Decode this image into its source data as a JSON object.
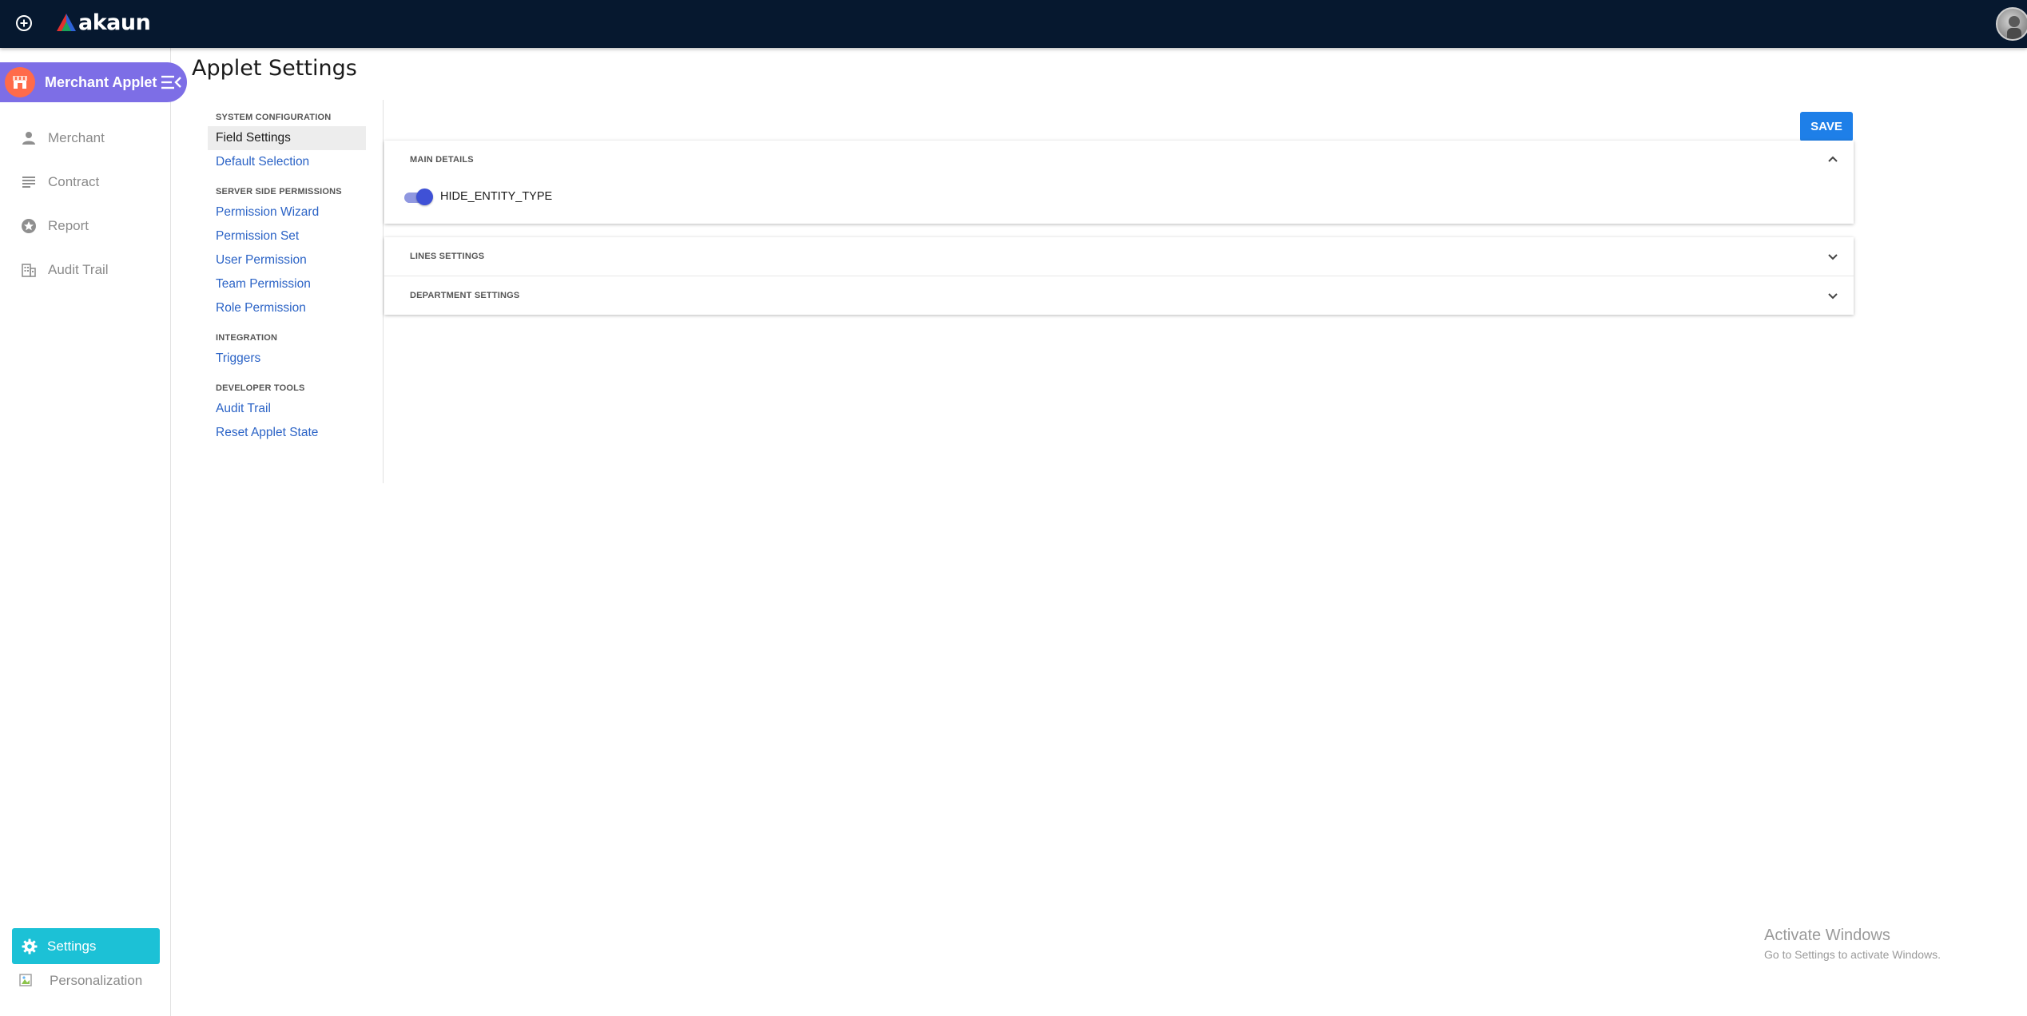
{
  "topbar": {
    "brand": "akaun",
    "add_icon": "plus-circle-icon",
    "avatar_icon": "user-avatar"
  },
  "sidebar": {
    "applet_name": "Merchant Applet",
    "items": [
      {
        "label": "Merchant",
        "icon": "person-icon"
      },
      {
        "label": "Contract",
        "icon": "list-icon"
      },
      {
        "label": "Report",
        "icon": "star-circle-icon"
      },
      {
        "label": "Audit Trail",
        "icon": "building-icon"
      }
    ],
    "settings_label": "Settings",
    "personalization_label": "Personalization"
  },
  "page": {
    "title": "Applet Settings"
  },
  "settings_nav": {
    "sections": [
      {
        "title": "SYSTEM CONFIGURATION",
        "links": [
          "Field Settings",
          "Default Selection"
        ]
      },
      {
        "title": "SERVER SIDE PERMISSIONS",
        "links": [
          "Permission Wizard",
          "Permission Set",
          "User Permission",
          "Team Permission",
          "Role Permission"
        ]
      },
      {
        "title": "INTEGRATION",
        "links": [
          "Triggers"
        ]
      },
      {
        "title": "DEVELOPER TOOLS",
        "links": [
          "Audit Trail",
          "Reset Applet State"
        ]
      }
    ],
    "active": "Field Settings"
  },
  "main": {
    "save_label": "SAVE",
    "panels": [
      {
        "title": "MAIN DETAILS",
        "expanded": true
      },
      {
        "title": "LINES SETTINGS",
        "expanded": false
      },
      {
        "title": "DEPARTMENT SETTINGS",
        "expanded": false
      }
    ],
    "toggle": {
      "label": "HIDE_ENTITY_TYPE",
      "on": true
    }
  },
  "watermark": {
    "line1": "Activate Windows",
    "line2": "Go to Settings to activate Windows."
  },
  "colors": {
    "topbar": "#06182f",
    "applet_pill": "#7d6ee6",
    "settings_button": "#1cc1d6",
    "save_button": "#1e7fe8",
    "link": "#2b63c6",
    "toggle": "#3f51d6"
  }
}
